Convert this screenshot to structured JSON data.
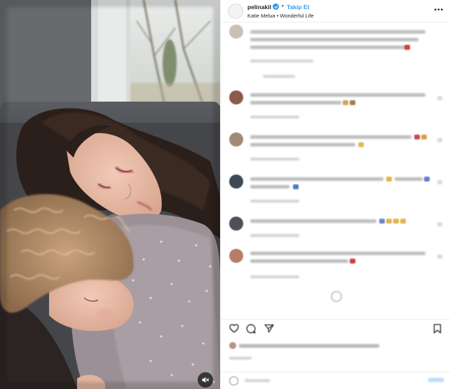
{
  "post": {
    "username": "pelinakil",
    "follow_label": "Takip Et",
    "separator": "•",
    "audio": "Katie Melua • Wonderful Life",
    "more_icon": "more-options-icon"
  },
  "colors": {
    "accent": "#3897f0",
    "verified": "#3897f0",
    "text": "#262626",
    "border": "#efefef"
  },
  "media": {
    "type": "video",
    "mute_icon": "volume-muted-icon"
  },
  "comments": {
    "content_blurred": true,
    "count_visible": 7
  },
  "actions": {
    "icons": [
      "heart-icon",
      "comment-icon",
      "share-icon",
      "bookmark-icon"
    ]
  },
  "composer": {
    "emoji_icon": "emoji-icon"
  }
}
